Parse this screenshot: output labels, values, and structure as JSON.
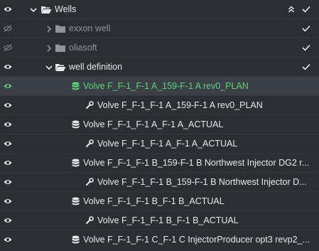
{
  "colors": {
    "background": "#2b2f33",
    "selected_row": "#3b4046",
    "accent_green": "#5cd37a",
    "text": "#e8e8e8",
    "dim_text": "#8f959b"
  },
  "tree": {
    "wells_label": "Wells",
    "exxon_label": "exxon well",
    "oliasoft_label": "oliasoft",
    "welldef_label": "well definition",
    "items": [
      {
        "label": "Volve F_F-1_F-1 A_159-F-1 A rev0_PLAN",
        "icon": "database-icon"
      },
      {
        "label": "Volve F_F-1_F-1 A_159-F-1 A rev0_PLAN",
        "icon": "wrench-icon"
      },
      {
        "label": "Volve F_F-1_F-1 A_F-1 A_ACTUAL",
        "icon": "database-icon"
      },
      {
        "label": "Volve F_F-1_F-1 A_F-1 A_ACTUAL",
        "icon": "wrench-icon"
      },
      {
        "label": "Volve F_F-1_F-1 B_159-F-1 B Northwest Injector DG2 r...",
        "icon": "database-icon"
      },
      {
        "label": "Volve F_F-1_F-1 B_159-F-1 B Northwest Injector D...",
        "icon": "wrench-icon"
      },
      {
        "label": "Volve F_F-1_F-1 B_F-1 B_ACTUAL",
        "icon": "database-icon"
      },
      {
        "label": "Volve F_F-1_F-1 B_F-1 B_ACTUAL",
        "icon": "wrench-icon"
      },
      {
        "label": "Volve F_F-1_F-1 C_F-1 C InjectorProducer opt3 revp2_...",
        "icon": "database-icon"
      }
    ]
  }
}
